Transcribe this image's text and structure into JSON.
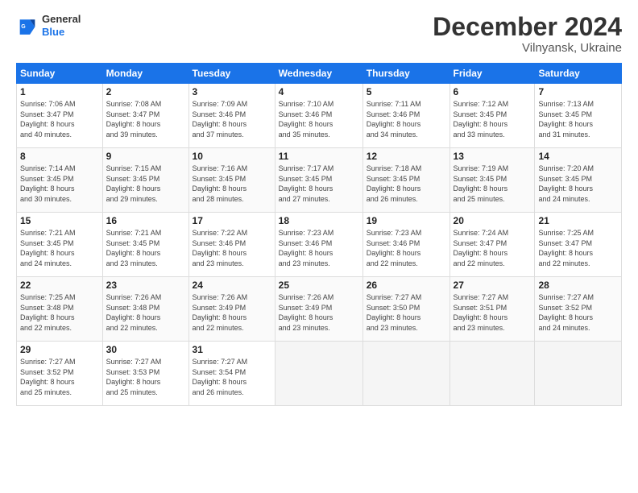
{
  "header": {
    "logo": {
      "line1": "General",
      "line2": "Blue"
    },
    "title": "December 2024",
    "subtitle": "Vilnyansk, Ukraine"
  },
  "weekdays": [
    "Sunday",
    "Monday",
    "Tuesday",
    "Wednesday",
    "Thursday",
    "Friday",
    "Saturday"
  ],
  "weeks": [
    [
      {
        "day": "1",
        "info": "Sunrise: 7:06 AM\nSunset: 3:47 PM\nDaylight: 8 hours\nand 40 minutes."
      },
      {
        "day": "2",
        "info": "Sunrise: 7:08 AM\nSunset: 3:47 PM\nDaylight: 8 hours\nand 39 minutes."
      },
      {
        "day": "3",
        "info": "Sunrise: 7:09 AM\nSunset: 3:46 PM\nDaylight: 8 hours\nand 37 minutes."
      },
      {
        "day": "4",
        "info": "Sunrise: 7:10 AM\nSunset: 3:46 PM\nDaylight: 8 hours\nand 35 minutes."
      },
      {
        "day": "5",
        "info": "Sunrise: 7:11 AM\nSunset: 3:46 PM\nDaylight: 8 hours\nand 34 minutes."
      },
      {
        "day": "6",
        "info": "Sunrise: 7:12 AM\nSunset: 3:45 PM\nDaylight: 8 hours\nand 33 minutes."
      },
      {
        "day": "7",
        "info": "Sunrise: 7:13 AM\nSunset: 3:45 PM\nDaylight: 8 hours\nand 31 minutes."
      }
    ],
    [
      {
        "day": "8",
        "info": "Sunrise: 7:14 AM\nSunset: 3:45 PM\nDaylight: 8 hours\nand 30 minutes."
      },
      {
        "day": "9",
        "info": "Sunrise: 7:15 AM\nSunset: 3:45 PM\nDaylight: 8 hours\nand 29 minutes."
      },
      {
        "day": "10",
        "info": "Sunrise: 7:16 AM\nSunset: 3:45 PM\nDaylight: 8 hours\nand 28 minutes."
      },
      {
        "day": "11",
        "info": "Sunrise: 7:17 AM\nSunset: 3:45 PM\nDaylight: 8 hours\nand 27 minutes."
      },
      {
        "day": "12",
        "info": "Sunrise: 7:18 AM\nSunset: 3:45 PM\nDaylight: 8 hours\nand 26 minutes."
      },
      {
        "day": "13",
        "info": "Sunrise: 7:19 AM\nSunset: 3:45 PM\nDaylight: 8 hours\nand 25 minutes."
      },
      {
        "day": "14",
        "info": "Sunrise: 7:20 AM\nSunset: 3:45 PM\nDaylight: 8 hours\nand 24 minutes."
      }
    ],
    [
      {
        "day": "15",
        "info": "Sunrise: 7:21 AM\nSunset: 3:45 PM\nDaylight: 8 hours\nand 24 minutes."
      },
      {
        "day": "16",
        "info": "Sunrise: 7:21 AM\nSunset: 3:45 PM\nDaylight: 8 hours\nand 23 minutes."
      },
      {
        "day": "17",
        "info": "Sunrise: 7:22 AM\nSunset: 3:46 PM\nDaylight: 8 hours\nand 23 minutes."
      },
      {
        "day": "18",
        "info": "Sunrise: 7:23 AM\nSunset: 3:46 PM\nDaylight: 8 hours\nand 23 minutes."
      },
      {
        "day": "19",
        "info": "Sunrise: 7:23 AM\nSunset: 3:46 PM\nDaylight: 8 hours\nand 22 minutes."
      },
      {
        "day": "20",
        "info": "Sunrise: 7:24 AM\nSunset: 3:47 PM\nDaylight: 8 hours\nand 22 minutes."
      },
      {
        "day": "21",
        "info": "Sunrise: 7:25 AM\nSunset: 3:47 PM\nDaylight: 8 hours\nand 22 minutes."
      }
    ],
    [
      {
        "day": "22",
        "info": "Sunrise: 7:25 AM\nSunset: 3:48 PM\nDaylight: 8 hours\nand 22 minutes."
      },
      {
        "day": "23",
        "info": "Sunrise: 7:26 AM\nSunset: 3:48 PM\nDaylight: 8 hours\nand 22 minutes."
      },
      {
        "day": "24",
        "info": "Sunrise: 7:26 AM\nSunset: 3:49 PM\nDaylight: 8 hours\nand 22 minutes."
      },
      {
        "day": "25",
        "info": "Sunrise: 7:26 AM\nSunset: 3:49 PM\nDaylight: 8 hours\nand 23 minutes."
      },
      {
        "day": "26",
        "info": "Sunrise: 7:27 AM\nSunset: 3:50 PM\nDaylight: 8 hours\nand 23 minutes."
      },
      {
        "day": "27",
        "info": "Sunrise: 7:27 AM\nSunset: 3:51 PM\nDaylight: 8 hours\nand 23 minutes."
      },
      {
        "day": "28",
        "info": "Sunrise: 7:27 AM\nSunset: 3:52 PM\nDaylight: 8 hours\nand 24 minutes."
      }
    ],
    [
      {
        "day": "29",
        "info": "Sunrise: 7:27 AM\nSunset: 3:52 PM\nDaylight: 8 hours\nand 25 minutes."
      },
      {
        "day": "30",
        "info": "Sunrise: 7:27 AM\nSunset: 3:53 PM\nDaylight: 8 hours\nand 25 minutes."
      },
      {
        "day": "31",
        "info": "Sunrise: 7:27 AM\nSunset: 3:54 PM\nDaylight: 8 hours\nand 26 minutes."
      },
      null,
      null,
      null,
      null
    ]
  ]
}
